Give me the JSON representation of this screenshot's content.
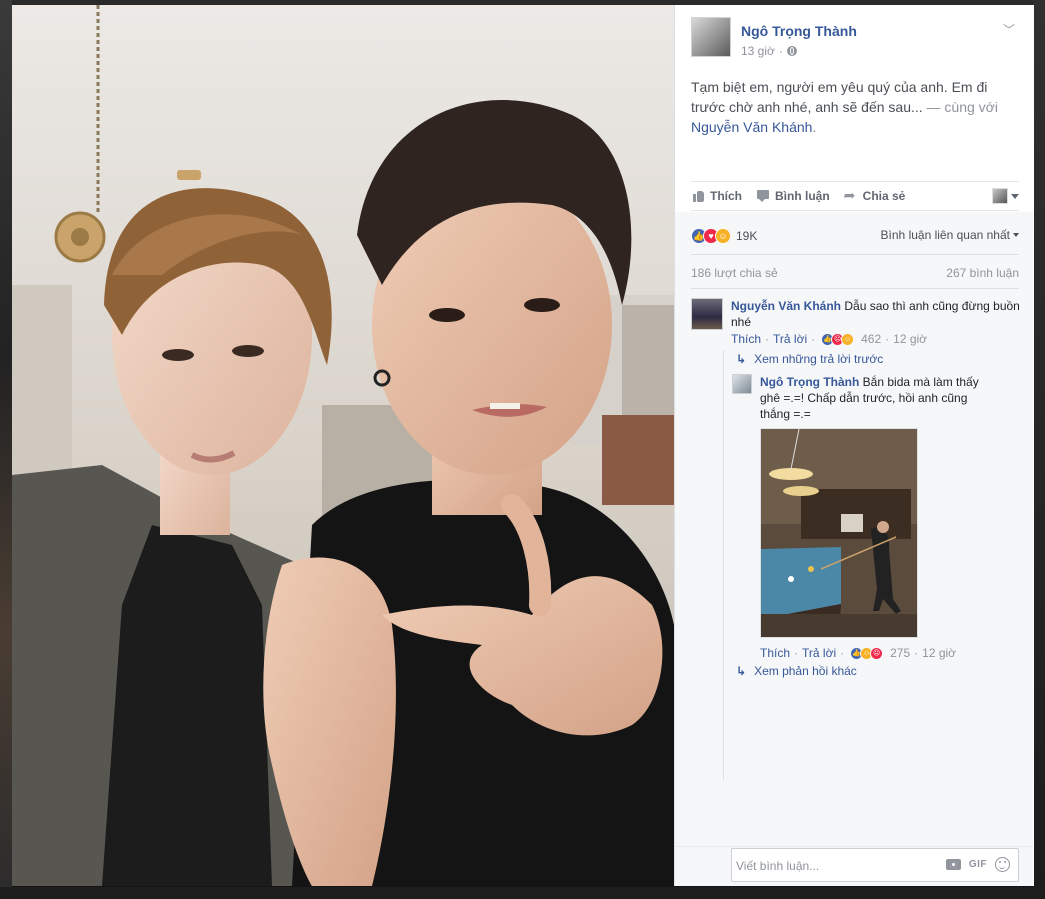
{
  "post": {
    "author": "Ngô Trọng Thành",
    "time": "13 giờ",
    "privacy_icon": "globe-icon",
    "text_main": "Tạm biệt em, người em yêu quý của anh. Em đi trước chờ anh nhé, anh sẽ đến sau...",
    "text_with": " — cùng với",
    "tagged_person": "Nguyễn Văn Khánh",
    "text_end": "."
  },
  "actions": {
    "like": "Thích",
    "comment": "Bình luận",
    "share": "Chia sẻ"
  },
  "stats": {
    "reaction_total": "19K",
    "sort_label": "Bình luận liên quan nhất",
    "shares": "186 lượt chia sẻ",
    "comments": "267 bình luận"
  },
  "comments": [
    {
      "author": "Nguyễn Văn Khánh",
      "text": " Dẫu sao thì anh cũng đừng buồn nhé",
      "like": "Thích",
      "reply": "Trả lời",
      "reaction_count": "462",
      "time": "12 giờ"
    }
  ],
  "thread": {
    "view_previous": "Xem những trả lời trước",
    "view_more": "Xem phản hồi khác",
    "reply": {
      "author": "Ngô Trọng Thành",
      "text": " Bắn bida mà làm thấy ghê =.=! Chấp dẫn trước, hồi anh cũng thắng =.=",
      "like": "Thích",
      "reply": "Trả lời",
      "reaction_count": "275",
      "time": "12 giờ"
    }
  },
  "composer": {
    "placeholder": "Viết bình luận...",
    "gif_label": "GIF"
  },
  "colors": {
    "link": "#365899",
    "like_blue": "#4267b2",
    "love_red": "#f0284a",
    "haha_yellow": "#f7b125"
  }
}
